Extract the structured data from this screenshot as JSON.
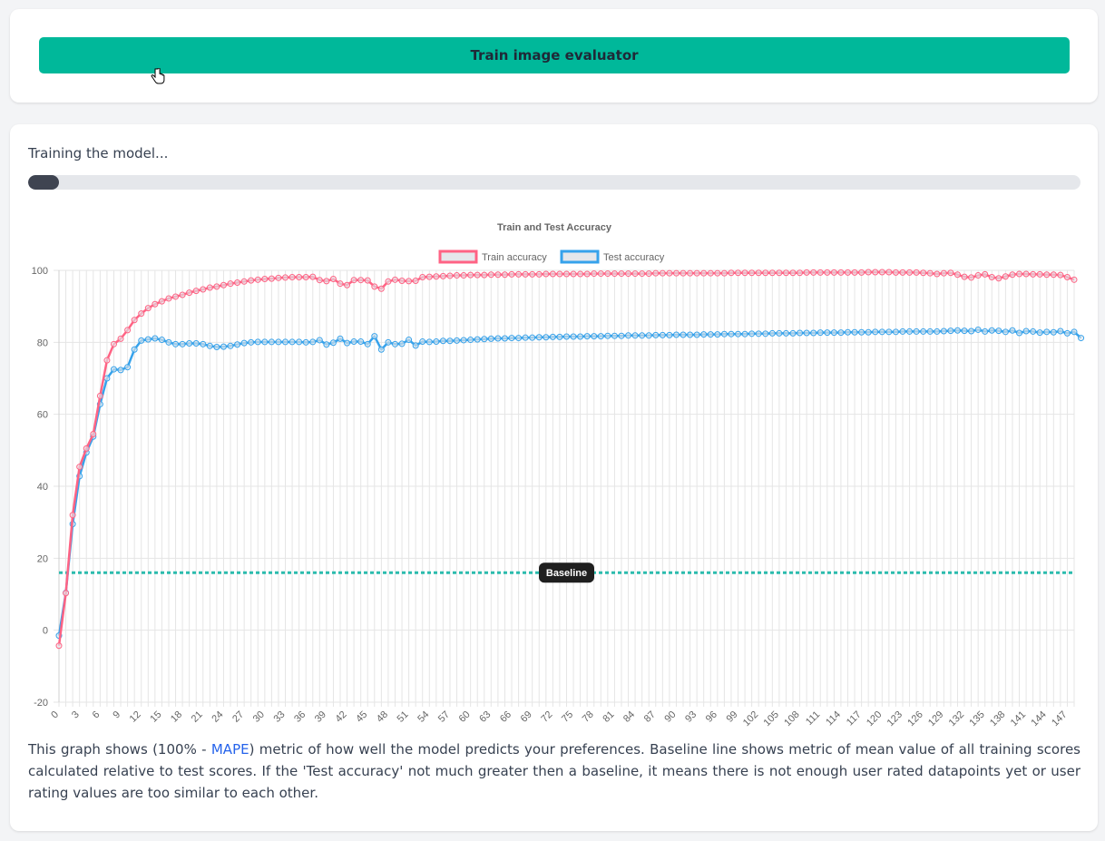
{
  "top_card": {
    "train_button_label": "Train image evaluator"
  },
  "training": {
    "status_text": "Training the model...",
    "progress_fraction": 0.029
  },
  "chart_data": {
    "type": "line",
    "title": "Train and Test Accuracy",
    "xlabel": "",
    "ylabel": "",
    "ylim": [
      -20,
      100
    ],
    "yticks": [
      -20,
      0,
      20,
      40,
      60,
      80,
      100
    ],
    "x_range": [
      0,
      148
    ],
    "x_tick_step": 3,
    "grid": true,
    "legend_placement": "top-center",
    "series": [
      {
        "name": "Train accuracy",
        "color": "#ff6384",
        "values": [
          -4.3,
          10.3,
          32,
          45.4,
          50.5,
          54.5,
          65.1,
          75,
          79.5,
          81,
          83.4,
          86.2,
          88,
          89.5,
          90.6,
          91.4,
          92.2,
          92.7,
          93.2,
          93.8,
          94.3,
          94.7,
          95.2,
          95.5,
          95.9,
          96.3,
          96.6,
          96.9,
          97.2,
          97.4,
          97.6,
          97.7,
          97.9,
          98,
          98.1,
          98.1,
          98.1,
          98.2,
          97.3,
          97,
          97.6,
          96.3,
          95.9,
          97.3,
          97.3,
          97.2,
          95.5,
          94.9,
          96.9,
          97.4,
          97.1,
          97,
          97.1,
          98.1,
          98.2,
          98.3,
          98.4,
          98.5,
          98.6,
          98.6,
          98.7,
          98.7,
          98.7,
          98.8,
          98.8,
          98.8,
          98.9,
          98.9,
          98.9,
          98.9,
          98.9,
          99,
          99,
          99,
          99,
          99,
          99,
          99,
          99.1,
          99.1,
          99.1,
          99.1,
          99.1,
          99.1,
          99.1,
          99.1,
          99.1,
          99.2,
          99.2,
          99.2,
          99.2,
          99.2,
          99.2,
          99.2,
          99.2,
          99.2,
          99.2,
          99.2,
          99.3,
          99.3,
          99.3,
          99.3,
          99.3,
          99.3,
          99.3,
          99.3,
          99.3,
          99.3,
          99.3,
          99.4,
          99.4,
          99.4,
          99.4,
          99.4,
          99.4,
          99.4,
          99.4,
          99.4,
          99.5,
          99.5,
          99.5,
          99.5,
          99.4,
          99.4,
          99.4,
          99.4,
          99.3,
          99.2,
          99,
          99.2,
          99.3,
          98.8,
          98.2,
          98,
          98.6,
          98.9,
          98.1,
          97.8,
          98.3,
          98.8,
          99,
          99,
          98.9,
          98.9,
          98.8,
          98.8,
          98.7,
          98.1,
          97.4
        ],
        "fill": "#e5e7eb"
      },
      {
        "name": "Test accuracy",
        "color": "#36a2eb",
        "values": [
          -1.5,
          10.4,
          29.5,
          42.8,
          49.4,
          53.8,
          62.8,
          70,
          72.5,
          72.3,
          73.1,
          78,
          80.5,
          80.8,
          81.1,
          80.7,
          80,
          79.5,
          79.5,
          79.7,
          79.7,
          79.5,
          79,
          78.7,
          78.8,
          79,
          79.4,
          79.8,
          80,
          80.1,
          80.1,
          80.1,
          80.1,
          80.1,
          80.1,
          80.1,
          80,
          80.1,
          80.6,
          79.4,
          79.9,
          81,
          79.8,
          80.2,
          80.2,
          79.5,
          81.7,
          78,
          80,
          79.5,
          79.6,
          80.7,
          79.1,
          80.2,
          80.1,
          80.2,
          80.4,
          80.4,
          80.5,
          80.6,
          80.7,
          80.8,
          80.9,
          81,
          81.1,
          81.1,
          81.2,
          81.2,
          81.3,
          81.3,
          81.4,
          81.4,
          81.5,
          81.5,
          81.6,
          81.6,
          81.6,
          81.7,
          81.7,
          81.7,
          81.8,
          81.8,
          81.8,
          81.9,
          81.9,
          81.9,
          81.9,
          82,
          82,
          82,
          82.1,
          82.1,
          82.1,
          82.1,
          82.2,
          82.2,
          82.2,
          82.3,
          82.3,
          82.3,
          82.3,
          82.4,
          82.4,
          82.4,
          82.5,
          82.5,
          82.5,
          82.5,
          82.6,
          82.6,
          82.6,
          82.7,
          82.7,
          82.7,
          82.7,
          82.8,
          82.8,
          82.8,
          82.8,
          82.9,
          82.9,
          82.9,
          82.9,
          83,
          83,
          83,
          83,
          83,
          83,
          83.1,
          83.2,
          83.3,
          83.2,
          83.1,
          83.5,
          83,
          83.3,
          83.2,
          82.9,
          83.3,
          82.6,
          83.1,
          83,
          82.7,
          82.9,
          82.8,
          83.1,
          82.5,
          82.9,
          81.2
        ],
        "fill": "#e5e7eb"
      }
    ],
    "baseline": {
      "label": "Baseline",
      "value": 16,
      "color": "#2bbbad"
    }
  },
  "description": {
    "before_link": "This graph shows (100% - ",
    "link_text": "MAPE",
    "after_link": ") metric of how well the model predicts your preferences. Baseline line shows metric of mean value of all training scores calculated relative to test scores. If the 'Test accuracy' not much greater then a baseline, it means there is not enough user rated datapoints yet or user rating values are too similar to each other."
  }
}
